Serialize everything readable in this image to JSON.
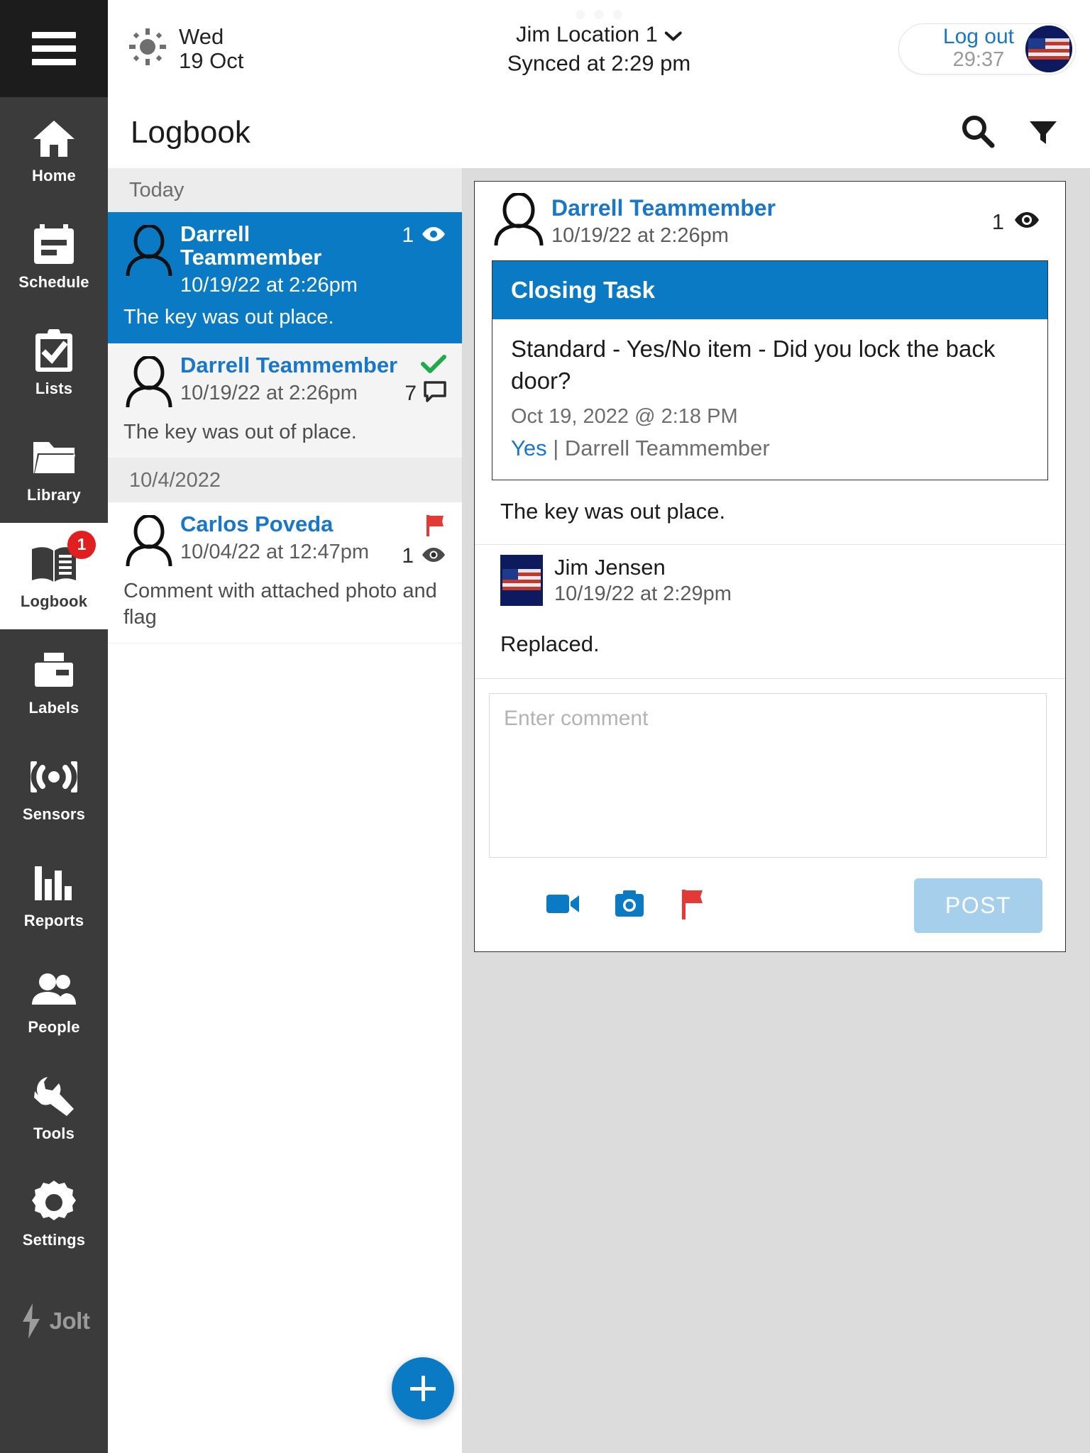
{
  "sidebar": {
    "menu_icon": "hamburger-icon",
    "items": [
      {
        "label": "Home",
        "icon": "home-icon",
        "active": false,
        "badge": null
      },
      {
        "label": "Schedule",
        "icon": "calendar-icon",
        "active": false,
        "badge": null
      },
      {
        "label": "Lists",
        "icon": "clipboard-check-icon",
        "active": false,
        "badge": null
      },
      {
        "label": "Library",
        "icon": "folder-icon",
        "active": false,
        "badge": null
      },
      {
        "label": "Logbook",
        "icon": "book-icon",
        "active": true,
        "badge": "1"
      },
      {
        "label": "Labels",
        "icon": "printer-icon",
        "active": false,
        "badge": null
      },
      {
        "label": "Sensors",
        "icon": "signal-icon",
        "active": false,
        "badge": null
      },
      {
        "label": "Reports",
        "icon": "bar-chart-icon",
        "active": false,
        "badge": null
      },
      {
        "label": "People",
        "icon": "people-icon",
        "active": false,
        "badge": null
      },
      {
        "label": "Tools",
        "icon": "wrench-icon",
        "active": false,
        "badge": null
      },
      {
        "label": "Settings",
        "icon": "gear-icon",
        "active": false,
        "badge": null
      }
    ],
    "brand": "Jolt"
  },
  "topbar": {
    "weather_icon": "sun-icon",
    "day": "Wed",
    "date": "19 Oct",
    "location": "Jim Location 1",
    "location_chevron": "chevron-down-icon",
    "sync_status": "Synced at 2:29 pm",
    "logout_label": "Log out",
    "logout_timer": "29:37",
    "avatar": "us-flag-avatar"
  },
  "page": {
    "title": "Logbook",
    "search_icon": "search-icon",
    "filter_icon": "filter-icon"
  },
  "list": {
    "groups": [
      {
        "label": "Today",
        "entries": [
          {
            "author": "Darrell Teammember",
            "timestamp": "10/19/22 at 2:26pm",
            "preview": "The key was out place.",
            "count": "1",
            "count_icon": "eye-icon",
            "selected": true,
            "checked": false,
            "flagged": false
          },
          {
            "author": "Darrell Teammember",
            "timestamp": "10/19/22 at 2:26pm",
            "preview": "The key was out of place.",
            "count": "7",
            "count_icon": "comment-icon",
            "selected": false,
            "checked": true,
            "flagged": false
          }
        ]
      },
      {
        "label": "10/4/2022",
        "entries": [
          {
            "author": "Carlos Poveda",
            "timestamp": "10/04/22 at 12:47pm",
            "preview": "Comment with attached photo and flag",
            "count": "1",
            "count_icon": "eye-icon",
            "selected": false,
            "checked": false,
            "flagged": true
          }
        ]
      }
    ],
    "add_button_icon": "plus-icon"
  },
  "detail": {
    "author": "Darrell Teammember",
    "timestamp": "10/19/22 at 2:26pm",
    "view_count": "1",
    "view_icon": "eye-icon",
    "task": {
      "title": "Closing Task",
      "question": "Standard - Yes/No item - Did you lock the back door?",
      "date": "Oct 19, 2022 @ 2:18 PM",
      "answer": "Yes",
      "answer_separator": "|",
      "answered_by": "Darrell Teammember"
    },
    "body": "The key was out place.",
    "comment": {
      "author": "Jim Jensen",
      "avatar": "us-flag-avatar",
      "timestamp": "10/19/22 at 2:29pm",
      "text": "Replaced."
    },
    "compose": {
      "placeholder": "Enter comment",
      "value": "",
      "video_icon": "video-camera-icon",
      "photo_icon": "camera-icon",
      "flag_icon": "flag-icon",
      "post_label": "POST"
    }
  },
  "colors": {
    "accent_blue": "#0b7ac4",
    "link_blue": "#1877c9",
    "sidebar_bg": "#3b3b3b",
    "badge_red": "#e02020",
    "flag_red": "#e53935",
    "check_green": "#1faa4b",
    "post_disabled": "#a5cfeb"
  }
}
